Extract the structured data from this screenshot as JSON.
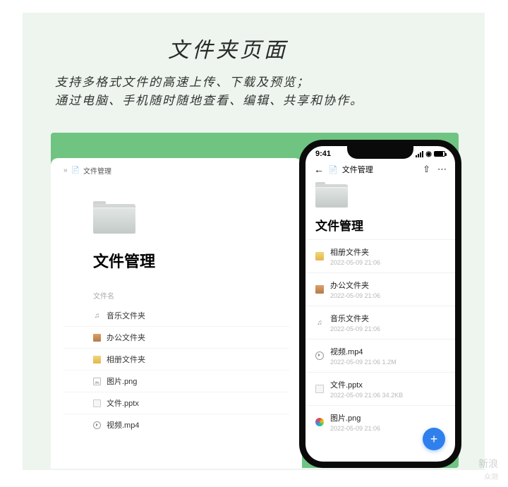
{
  "header": {
    "title": "文件夹页面",
    "subtitle_line1": "支持多格式文件的高速上传、下载及预览；",
    "subtitle_line2": "通过电脑、手机随时随地查看、编辑、共享和协作。"
  },
  "desktop": {
    "breadcrumb": "文件管理",
    "folder_title": "文件管理",
    "column_header": "文件名",
    "items": [
      {
        "icon": "music",
        "name": "音乐文件夹"
      },
      {
        "icon": "office",
        "name": "办公文件夹"
      },
      {
        "icon": "album",
        "name": "相册文件夹"
      },
      {
        "icon": "img",
        "name": "图片.png"
      },
      {
        "icon": "doc",
        "name": "文件.pptx"
      },
      {
        "icon": "play",
        "name": "视频.mp4"
      }
    ]
  },
  "phone": {
    "status_time": "9:41",
    "breadcrumb": "文件管理",
    "folder_title": "文件管理",
    "items": [
      {
        "icon": "album",
        "name": "相册文件夹",
        "meta": "2022-05-09 21:06"
      },
      {
        "icon": "office",
        "name": "办公文件夹",
        "meta": "2022-05-09 21:06"
      },
      {
        "icon": "music",
        "name": "音乐文件夹",
        "meta": "2022-05-09 21:06"
      },
      {
        "icon": "play",
        "name": "视频.mp4",
        "meta": "2022-05-09 21:06   1.2M"
      },
      {
        "icon": "doc",
        "name": "文件.pptx",
        "meta": "2022-05-09 21:06   34.2KB"
      },
      {
        "icon": "img-color",
        "name": "图片.png",
        "meta": "2022-05-09 21:06"
      }
    ],
    "fab_label": "+"
  },
  "watermark": {
    "brand": "新浪",
    "sub": "众测"
  }
}
